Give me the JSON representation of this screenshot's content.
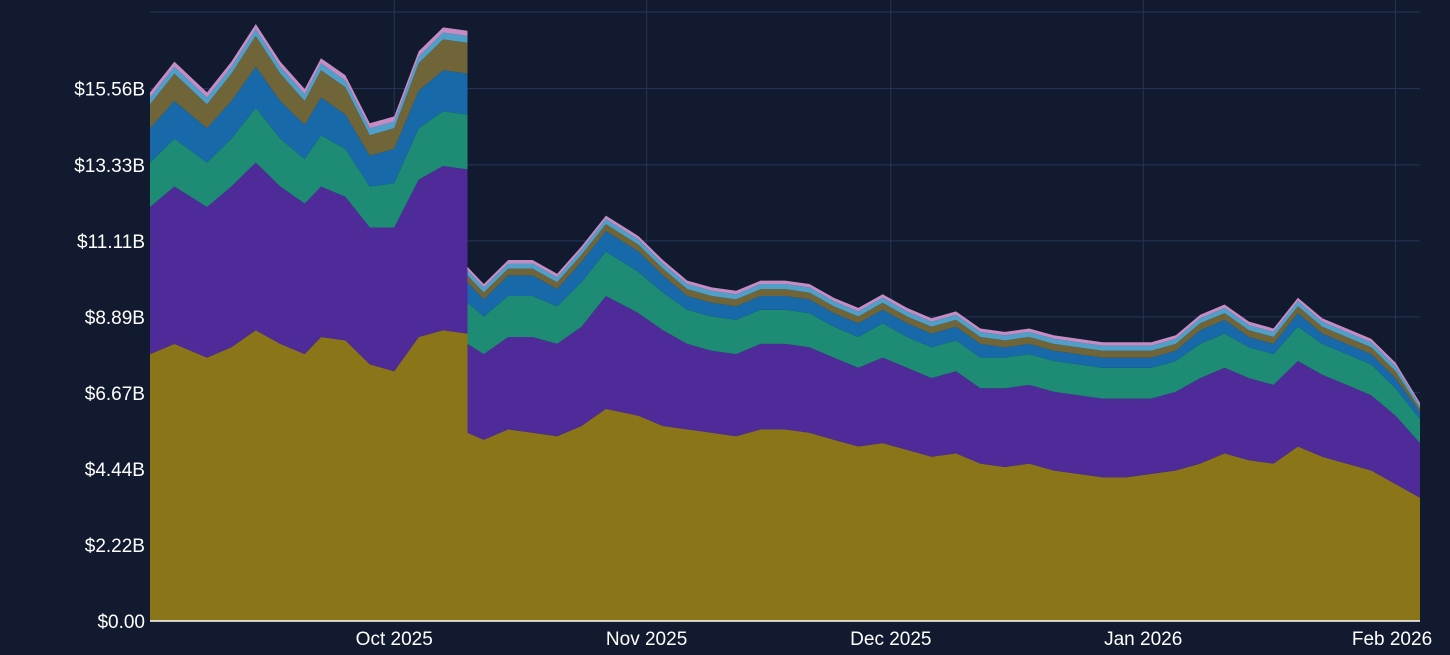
{
  "colors": {
    "background": "#111a2e",
    "grid": "#27355a",
    "axis_text": "#ffffff",
    "series": [
      "#8a7519",
      "#4f2b9a",
      "#1e8b74",
      "#1769aa",
      "#6f6538",
      "#4f9fc8",
      "#c58cc4"
    ]
  },
  "chart_data": {
    "type": "area",
    "stacked": true,
    "grid": true,
    "legend": "none",
    "title": "",
    "xlabel": "",
    "ylabel": "",
    "x_range": [
      "2025-09-01",
      "2026-02-04"
    ],
    "ylim": [
      0,
      17.8
    ],
    "y_ticks": [
      0,
      2.22,
      4.44,
      6.67,
      8.89,
      11.11,
      13.33,
      15.56
    ],
    "y_tick_labels": [
      "$0.00",
      "$2.22B",
      "$4.44B",
      "$6.67B",
      "$8.89B",
      "$11.11B",
      "$13.33B",
      "$15.56B"
    ],
    "x_ticks": [
      "2025-10-01",
      "2025-11-01",
      "2025-12-01",
      "2026-01-01",
      "2026-02-01"
    ],
    "x_tick_labels": [
      "Oct 2025",
      "Nov 2025",
      "Dec 2025",
      "Jan 2026",
      "Feb 2026"
    ],
    "x": [
      "2025-09-01",
      "2025-09-04",
      "2025-09-08",
      "2025-09-11",
      "2025-09-14",
      "2025-09-17",
      "2025-09-20",
      "2025-09-22",
      "2025-09-25",
      "2025-09-28",
      "2025-10-01",
      "2025-10-04",
      "2025-10-07",
      "2025-10-10",
      "2025-10-10",
      "2025-10-12",
      "2025-10-15",
      "2025-10-18",
      "2025-10-21",
      "2025-10-24",
      "2025-10-27",
      "2025-10-31",
      "2025-11-03",
      "2025-11-06",
      "2025-11-09",
      "2025-11-12",
      "2025-11-15",
      "2025-11-18",
      "2025-11-21",
      "2025-11-24",
      "2025-11-27",
      "2025-11-30",
      "2025-12-03",
      "2025-12-06",
      "2025-12-09",
      "2025-12-12",
      "2025-12-15",
      "2025-12-18",
      "2025-12-21",
      "2025-12-24",
      "2025-12-27",
      "2025-12-30",
      "2026-01-02",
      "2026-01-05",
      "2026-01-08",
      "2026-01-11",
      "2026-01-14",
      "2026-01-17",
      "2026-01-20",
      "2026-01-23",
      "2026-01-26",
      "2026-01-29",
      "2026-02-01",
      "2026-02-04"
    ],
    "series": [
      {
        "values": [
          7.8,
          8.1,
          7.7,
          8.0,
          8.5,
          8.1,
          7.8,
          8.3,
          8.2,
          7.5,
          7.3,
          8.3,
          8.5,
          8.4,
          5.5,
          5.3,
          5.6,
          5.5,
          5.4,
          5.7,
          6.2,
          6.0,
          5.7,
          5.6,
          5.5,
          5.4,
          5.6,
          5.6,
          5.5,
          5.3,
          5.1,
          5.2,
          5.0,
          4.8,
          4.9,
          4.6,
          4.5,
          4.6,
          4.4,
          4.3,
          4.2,
          4.2,
          4.3,
          4.4,
          4.6,
          4.9,
          4.7,
          4.6,
          5.1,
          4.8,
          4.6,
          4.4,
          4.0,
          3.6
        ]
      },
      {
        "values": [
          4.3,
          4.6,
          4.4,
          4.7,
          4.9,
          4.6,
          4.4,
          4.4,
          4.2,
          4.0,
          4.2,
          4.6,
          4.8,
          4.8,
          2.6,
          2.5,
          2.7,
          2.8,
          2.7,
          2.9,
          3.3,
          3.0,
          2.8,
          2.5,
          2.4,
          2.4,
          2.5,
          2.5,
          2.5,
          2.4,
          2.3,
          2.5,
          2.4,
          2.3,
          2.4,
          2.2,
          2.3,
          2.3,
          2.3,
          2.3,
          2.3,
          2.3,
          2.2,
          2.3,
          2.5,
          2.5,
          2.4,
          2.3,
          2.5,
          2.4,
          2.3,
          2.2,
          2.0,
          1.6
        ]
      },
      {
        "values": [
          1.3,
          1.4,
          1.3,
          1.4,
          1.6,
          1.4,
          1.3,
          1.5,
          1.4,
          1.2,
          1.3,
          1.5,
          1.6,
          1.6,
          1.2,
          1.1,
          1.2,
          1.2,
          1.1,
          1.3,
          1.3,
          1.2,
          1.1,
          1.0,
          1.0,
          1.0,
          1.0,
          1.0,
          1.0,
          0.9,
          0.9,
          1.0,
          0.9,
          0.9,
          0.9,
          0.9,
          0.9,
          0.9,
          0.9,
          0.9,
          0.9,
          0.9,
          0.9,
          0.9,
          1.0,
          1.0,
          0.9,
          0.9,
          1.0,
          0.9,
          0.9,
          0.9,
          0.8,
          0.7
        ]
      },
      {
        "values": [
          1.0,
          1.1,
          1.0,
          1.1,
          1.2,
          1.1,
          1.0,
          1.1,
          1.0,
          0.9,
          1.0,
          1.1,
          1.2,
          1.2,
          0.6,
          0.5,
          0.6,
          0.6,
          0.5,
          0.6,
          0.6,
          0.6,
          0.5,
          0.4,
          0.4,
          0.4,
          0.4,
          0.4,
          0.4,
          0.4,
          0.4,
          0.4,
          0.4,
          0.4,
          0.4,
          0.4,
          0.3,
          0.3,
          0.3,
          0.3,
          0.3,
          0.3,
          0.3,
          0.3,
          0.4,
          0.4,
          0.3,
          0.3,
          0.4,
          0.3,
          0.3,
          0.3,
          0.3,
          0.2
        ]
      },
      {
        "values": [
          0.7,
          0.8,
          0.7,
          0.8,
          0.9,
          0.8,
          0.7,
          0.8,
          0.8,
          0.6,
          0.6,
          0.8,
          0.9,
          0.9,
          0.2,
          0.2,
          0.2,
          0.2,
          0.2,
          0.2,
          0.2,
          0.2,
          0.2,
          0.2,
          0.2,
          0.2,
          0.2,
          0.2,
          0.2,
          0.2,
          0.2,
          0.2,
          0.2,
          0.2,
          0.2,
          0.2,
          0.2,
          0.2,
          0.2,
          0.2,
          0.2,
          0.2,
          0.2,
          0.2,
          0.2,
          0.2,
          0.2,
          0.2,
          0.2,
          0.2,
          0.2,
          0.2,
          0.2,
          0.1
        ]
      },
      {
        "values": [
          0.2,
          0.2,
          0.2,
          0.2,
          0.2,
          0.2,
          0.2,
          0.2,
          0.2,
          0.2,
          0.2,
          0.2,
          0.2,
          0.2,
          0.15,
          0.15,
          0.15,
          0.15,
          0.15,
          0.15,
          0.15,
          0.15,
          0.15,
          0.15,
          0.15,
          0.15,
          0.15,
          0.15,
          0.15,
          0.15,
          0.15,
          0.15,
          0.15,
          0.15,
          0.15,
          0.15,
          0.15,
          0.15,
          0.15,
          0.15,
          0.15,
          0.15,
          0.15,
          0.15,
          0.15,
          0.15,
          0.15,
          0.15,
          0.15,
          0.15,
          0.15,
          0.15,
          0.15,
          0.1
        ]
      },
      {
        "values": [
          0.15,
          0.15,
          0.15,
          0.15,
          0.15,
          0.15,
          0.15,
          0.15,
          0.15,
          0.15,
          0.15,
          0.15,
          0.15,
          0.15,
          0.1,
          0.1,
          0.1,
          0.1,
          0.1,
          0.1,
          0.1,
          0.1,
          0.1,
          0.1,
          0.1,
          0.1,
          0.1,
          0.1,
          0.1,
          0.1,
          0.1,
          0.1,
          0.1,
          0.1,
          0.1,
          0.1,
          0.1,
          0.1,
          0.1,
          0.1,
          0.1,
          0.1,
          0.1,
          0.1,
          0.1,
          0.1,
          0.1,
          0.1,
          0.1,
          0.1,
          0.1,
          0.1,
          0.1,
          0.08
        ]
      }
    ]
  }
}
